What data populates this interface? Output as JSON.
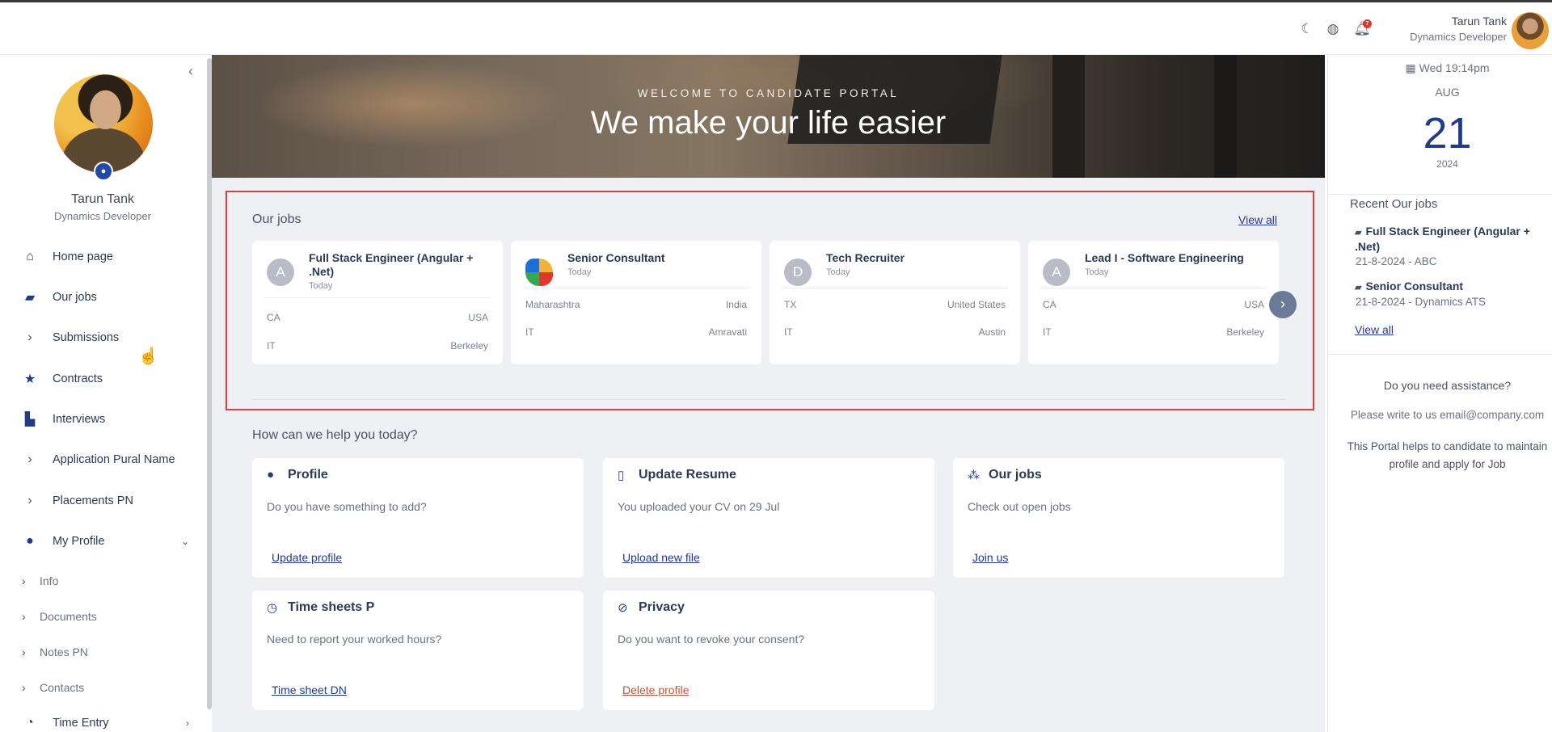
{
  "header": {
    "user_name": "Tarun Tank",
    "user_role": "Dynamics Developer",
    "notification_count": "7",
    "icons": [
      "moon-icon",
      "globe-icon",
      "bell-icon"
    ]
  },
  "sidebar": {
    "user_name": "Tarun Tank",
    "user_role": "Dynamics Developer",
    "items": [
      {
        "label": "Home page",
        "icon": "home-icon"
      },
      {
        "label": "Our jobs",
        "icon": "briefcase-icon"
      },
      {
        "label": "Submissions",
        "icon": "chevron-right-icon"
      },
      {
        "label": "Contracts",
        "icon": "star-icon"
      },
      {
        "label": "Interviews",
        "icon": "chart-icon"
      },
      {
        "label": "Application Pural Name",
        "icon": "chevron-right-icon"
      },
      {
        "label": "Placements PN",
        "icon": "chevron-right-icon"
      },
      {
        "label": "My Profile",
        "icon": "user-icon"
      }
    ],
    "profile_sub_items": [
      "Info",
      "Documents",
      "Notes PN",
      "Contacts"
    ],
    "time_entry": "Time Entry"
  },
  "banner": {
    "subtitle": "WELCOME TO CANDIDATE PORTAL",
    "title": "We make your life easier"
  },
  "our_jobs": {
    "title": "Our jobs",
    "view_all": "View all",
    "jobs": [
      {
        "logo": "A",
        "title": "Full Stack Engineer (Angular + .Net)",
        "posted": "Today",
        "row1_left": "CA",
        "row1_right": "USA",
        "row2_left": "IT",
        "row2_right": "Berkeley"
      },
      {
        "logo": "",
        "title": "Senior Consultant",
        "posted": "Today",
        "row1_left": "Maharashtra",
        "row1_right": "India",
        "row2_left": "IT",
        "row2_right": "Amravati"
      },
      {
        "logo": "D",
        "title": "Tech Recruiter",
        "posted": "Today",
        "row1_left": "TX",
        "row1_right": "United States",
        "row2_left": "IT",
        "row2_right": "Austin"
      },
      {
        "logo": "A",
        "title": "Lead I - Software Engineering",
        "posted": "Today",
        "row1_left": "CA",
        "row1_right": "USA",
        "row2_left": "IT",
        "row2_right": "Berkeley"
      }
    ]
  },
  "help": {
    "title": "How can we help you today?",
    "cards": [
      {
        "title": "Profile",
        "desc": "Do you have something to add?",
        "link": "Update profile",
        "icon": "user-icon"
      },
      {
        "title": "Update Resume",
        "desc": "You uploaded your CV on 29 Jul",
        "link": "Upload new file",
        "icon": "file-icon"
      },
      {
        "title": "Our jobs",
        "desc": "Check out open jobs",
        "link": "Join us",
        "icon": "group-icon"
      },
      {
        "title": "Time sheets P",
        "desc": "Need to report your worked hours?",
        "link": "Time sheet DN",
        "icon": "clock-icon"
      },
      {
        "title": "Privacy",
        "desc": "Do you want to revoke your consent?",
        "link": "Delete profile",
        "icon": "ban-icon"
      }
    ]
  },
  "right_panel": {
    "date_line": "Wed 19:14pm",
    "month": "AUG",
    "day": "21",
    "year": "2024",
    "recent_title": "Recent Our jobs",
    "recent": [
      {
        "title": "Full Stack Engineer (Angular + .Net)",
        "meta": "21-8-2024 - ABC"
      },
      {
        "title": "Senior Consultant",
        "meta": "21-8-2024 - Dynamics ATS"
      }
    ],
    "view_all": "View all",
    "assist_title": "Do you need assistance?",
    "assist_email": "Please write to us email@company.com",
    "assist_text_1": "This Portal helps to candidate to maintain",
    "assist_text_2": "profile and apply for Job"
  },
  "colors": {
    "accent": "#1f3b8a",
    "highlight_border": "#e33a3a",
    "danger_link": "#c0563c"
  }
}
